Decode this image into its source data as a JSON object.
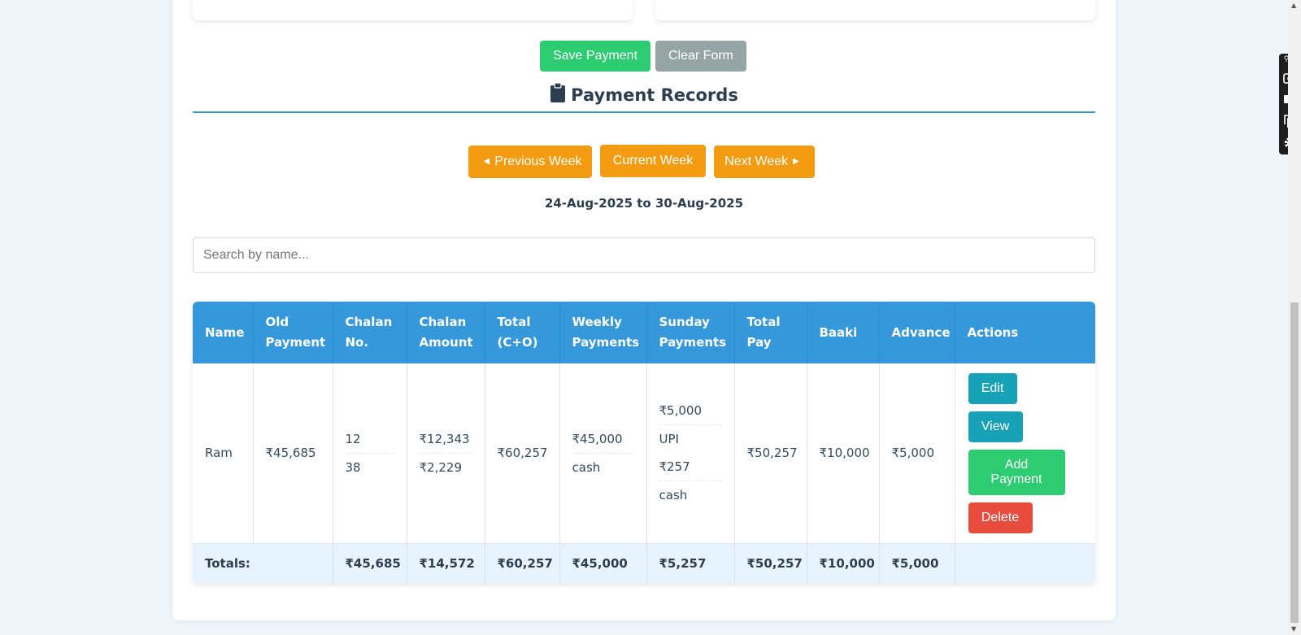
{
  "form": {
    "save_label": "Save Payment",
    "clear_label": "Clear Form"
  },
  "records": {
    "title": "Payment Records",
    "prev_week": "Previous Week",
    "current_week": "Current Week",
    "next_week": "Next Week",
    "date_range": "24-Aug-2025 to 30-Aug-2025",
    "search_placeholder": "Search by name..."
  },
  "table": {
    "headers": {
      "name": "Name",
      "old_payment": "Old Payment",
      "chalan_no": "Chalan No.",
      "chalan_amount": "Chalan Amount",
      "total_co": "Total (C+O)",
      "weekly_payments": "Weekly Payments",
      "sunday_payments": "Sunday Payments",
      "total_pay": "Total Pay",
      "baaki": "Baaki",
      "advance": "Advance",
      "actions": "Actions"
    },
    "rows": [
      {
        "name": "Ram",
        "old_payment": "₹45,685",
        "chalan_no": [
          "12",
          "38"
        ],
        "chalan_amount": [
          "₹12,343",
          "₹2,229"
        ],
        "total_co": "₹60,257",
        "weekly_payments": [
          "₹45,000",
          "cash"
        ],
        "sunday_payments": [
          "₹5,000",
          "UPI",
          "₹257",
          "cash"
        ],
        "total_pay": "₹50,257",
        "baaki": "₹10,000",
        "advance": "₹5,000",
        "actions": {
          "edit": "Edit",
          "view": "View",
          "add_payment": "Add Payment",
          "delete": "Delete"
        }
      }
    ],
    "totals": {
      "label": "Totals:",
      "old_payment": "₹45,685",
      "chalan_amount": "₹14,572",
      "total_co": "₹60,257",
      "weekly_payments": "₹45,000",
      "sunday_payments": "₹5,257",
      "total_pay": "₹50,257",
      "baaki": "₹10,000",
      "advance": "₹5,000"
    }
  },
  "colors": {
    "primary": "#3498db",
    "success": "#2ecc71",
    "warning": "#f39c12",
    "info": "#17a2b8",
    "danger": "#e74c3c",
    "muted": "#95a5a6"
  },
  "icons": {
    "title_icon": "clipboard-icon",
    "prev_icon": "triangle-left-icon",
    "next_icon": "triangle-right-icon",
    "toolbar": [
      "camera-icon",
      "video-icon",
      "copy-icon",
      "gear-icon"
    ]
  }
}
